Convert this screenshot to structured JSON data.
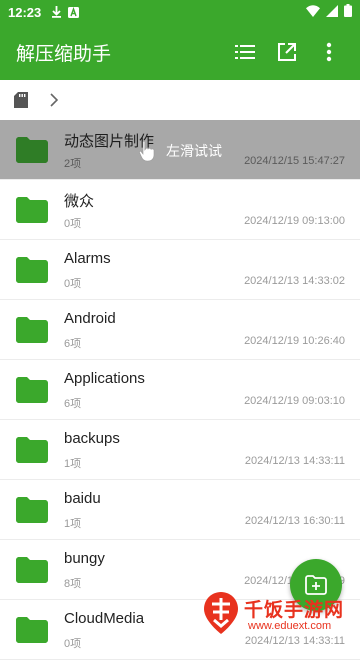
{
  "status": {
    "time": "12:23"
  },
  "appbar": {
    "title": "解压缩助手",
    "list_icon": "list-icon",
    "open_icon": "open-external-icon",
    "more_icon": "more-vert-icon"
  },
  "path": {
    "storage_icon": "sd-card-icon",
    "chevron_icon": "chevron-right-icon"
  },
  "swipe_hint": "左滑试试",
  "files": [
    {
      "name": "动态图片制作",
      "count": "2项",
      "date": "2024/12/15 15:47:27"
    },
    {
      "name": "微众",
      "count": "0项",
      "date": "2024/12/19 09:13:00"
    },
    {
      "name": "Alarms",
      "count": "0项",
      "date": "2024/12/13 14:33:02"
    },
    {
      "name": "Android",
      "count": "6项",
      "date": "2024/12/19 10:26:40"
    },
    {
      "name": "Applications",
      "count": "6项",
      "date": "2024/12/19 09:03:10"
    },
    {
      "name": "backups",
      "count": "1项",
      "date": "2024/12/13 14:33:11"
    },
    {
      "name": "baidu",
      "count": "1项",
      "date": "2024/12/13 16:30:11"
    },
    {
      "name": "bungy",
      "count": "8项",
      "date": "2024/12/19 16:03:39"
    },
    {
      "name": "CloudMedia",
      "count": "0项",
      "date": "2024/12/13 14:33:11"
    }
  ],
  "watermark": {
    "name": "千饭手游网",
    "url": "www.eduext.com"
  },
  "colors": {
    "primary": "#3ba82c",
    "folder": "#3ba82c",
    "highlight": "#a8a8a8",
    "watermark": "#e8321e"
  }
}
